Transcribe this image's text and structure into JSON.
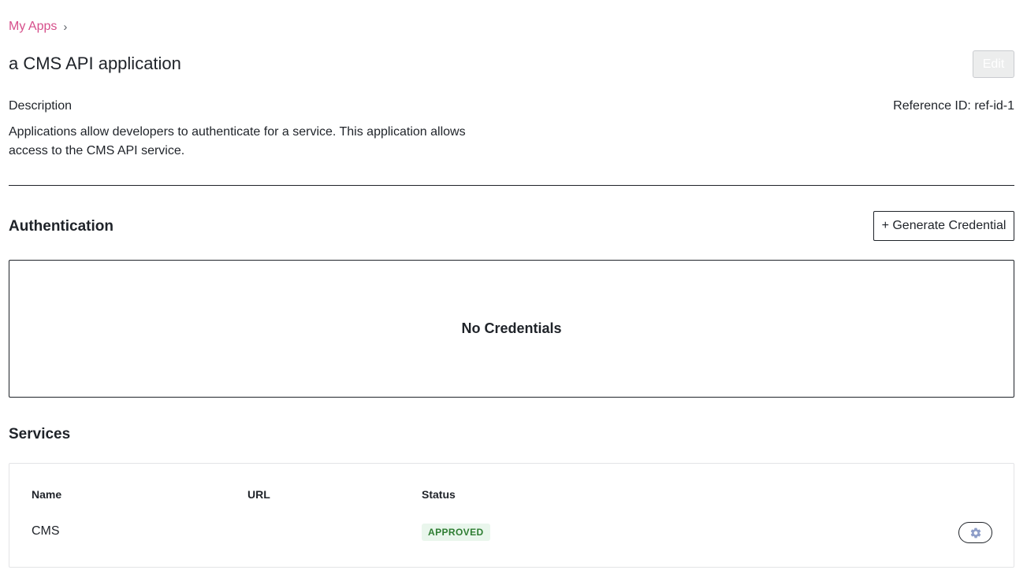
{
  "breadcrumb": {
    "parent": "My Apps",
    "separator": "›"
  },
  "app": {
    "title": "a CMS API application",
    "edit_label": "Edit",
    "description_label": "Description",
    "reference_id": "Reference ID: ref-id-1",
    "description": "Applications allow developers to authenticate for a service. This application allows access to the CMS API service."
  },
  "authentication": {
    "title": "Authentication",
    "generate_label": "+ Generate Credential",
    "empty_message": "No Credentials"
  },
  "services": {
    "title": "Services",
    "columns": [
      "Name",
      "URL",
      "Status"
    ],
    "rows": [
      {
        "name": "CMS",
        "url": "",
        "status": "APPROVED"
      }
    ],
    "settings_icon": "gear-icon"
  },
  "colors": {
    "breadcrumb_link": "#d64f8b",
    "approved_bg": "#e9f6ec",
    "approved_text": "#2e7d32",
    "gear_icon": "#8e9ec8"
  }
}
